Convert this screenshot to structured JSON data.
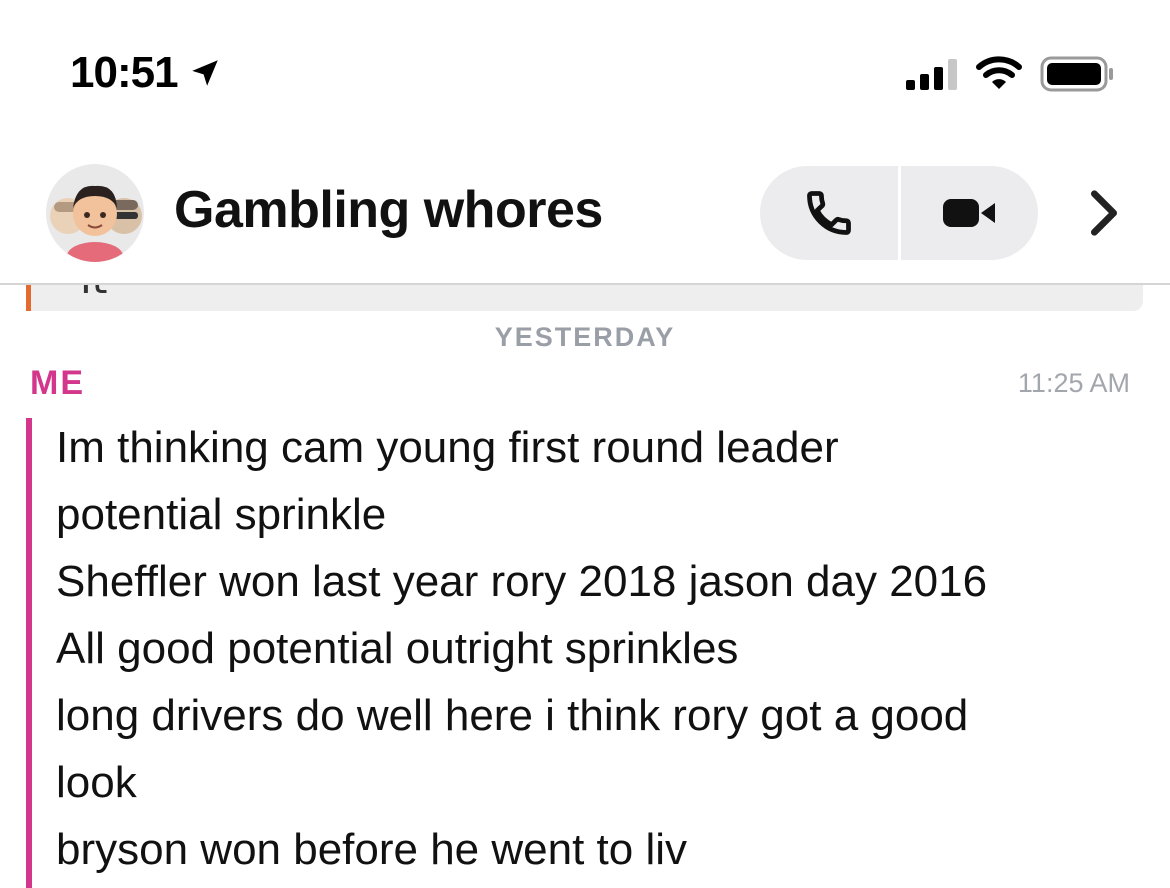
{
  "status_bar": {
    "time": "10:51",
    "location_icon": "location-arrow-icon",
    "signal_icon": "cellular-signal-icon",
    "wifi_icon": "wifi-icon",
    "battery_icon": "battery-icon"
  },
  "header": {
    "title": "Gambling whores",
    "avatar_icon": "group-avatar-icon",
    "call_icon": "phone-icon",
    "video_icon": "video-camera-icon",
    "more_icon": "chevron-right-icon"
  },
  "quoted": {
    "text": "It",
    "accent_color": "#e46a2f"
  },
  "day_separator": "YESTERDAY",
  "message": {
    "sender": "ME",
    "time": "11:25 AM",
    "sender_color": "#d3378c",
    "lines": [
      "Im thinking cam young first round leader",
      "potential sprinkle",
      "Sheffler won last year rory 2018 jason day 2016",
      "All good potential outright sprinkles",
      "long drivers do well here i think rory got a good",
      "look",
      "bryson won before he went to liv"
    ]
  }
}
